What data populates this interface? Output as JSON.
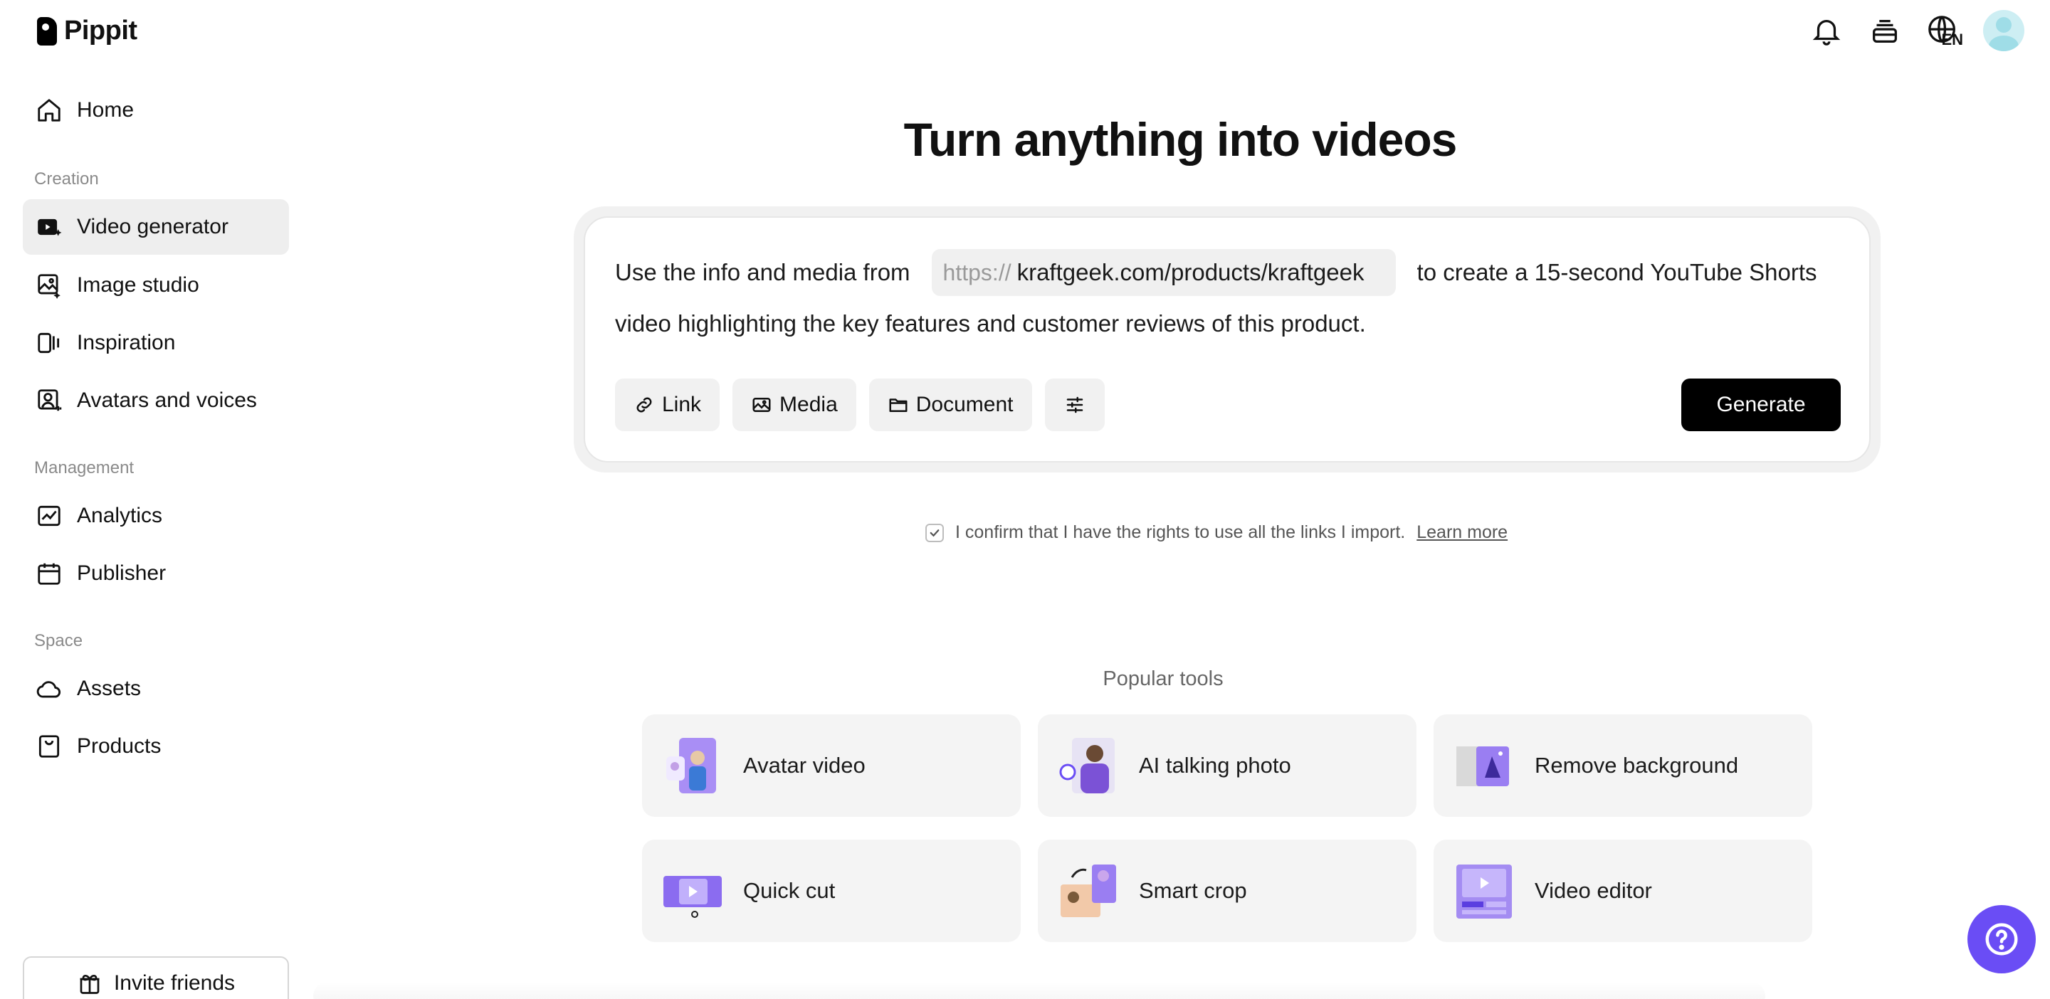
{
  "brand": {
    "name": "Pippit"
  },
  "sidebar": {
    "home": "Home",
    "sections": {
      "creation": "Creation",
      "management": "Management",
      "space": "Space"
    },
    "creation_items": [
      "Video generator",
      "Image studio",
      "Inspiration",
      "Avatars and voices"
    ],
    "management_items": [
      "Analytics",
      "Publisher"
    ],
    "space_items": [
      "Assets",
      "Products"
    ],
    "active_item": "Video generator",
    "invite": "Invite friends"
  },
  "topbar": {
    "language": "EN",
    "icons": [
      "bell-icon",
      "stack-icon",
      "globe-icon",
      "avatar"
    ]
  },
  "main": {
    "title": "Turn anything into videos",
    "prompt": {
      "prefix": "Use the info and media from",
      "url_protocol": "https://",
      "url": "kraftgeek.com/products/kraftgeek",
      "suffix": "to create a 15-second YouTube Shorts",
      "line2": "video highlighting the key features and customer reviews of this product."
    },
    "buttons": {
      "link": "Link",
      "media": "Media",
      "document": "Document",
      "generate": "Generate"
    },
    "confirm_text": "I confirm that I have the rights to use all the links I import.",
    "learn_more": "Learn more",
    "popular_label": "Popular tools",
    "tools": [
      "Avatar video",
      "AI talking photo",
      "Remove background",
      "Quick cut",
      "Smart crop",
      "Video editor"
    ]
  },
  "colors": {
    "accent": "#6a4df5",
    "active_bg": "#eeeeee",
    "generate_bg": "#000000"
  }
}
